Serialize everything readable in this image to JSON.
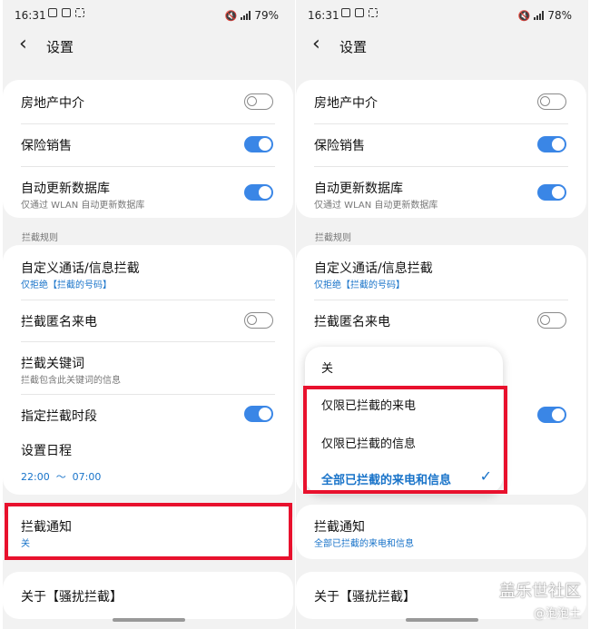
{
  "status_left": {
    "time": "16:31",
    "battery": "79%"
  },
  "status_right": {
    "time": "16:31",
    "battery": "78%"
  },
  "appbar": {
    "title": "设置"
  },
  "settings": {
    "real_estate": {
      "label": "房地产中介",
      "enabled": false
    },
    "insurance": {
      "label": "保险销售",
      "enabled": true
    },
    "auto_update": {
      "label": "自动更新数据库",
      "sub": "仅通过 WLAN 自动更新数据库",
      "enabled": true
    }
  },
  "block_rules": {
    "header": "拦截规则",
    "custom": {
      "label": "自定义通话/信息拦截",
      "sub": "仅拒绝【拦截的号码】"
    },
    "anonymous": {
      "label": "拦截匿名来电",
      "enabled": false
    },
    "keywords": {
      "label": "拦截关键词",
      "sub": "拦截包含此关键词的信息"
    },
    "time_slot": {
      "label": "指定拦截时段",
      "enabled": true
    },
    "schedule": {
      "label": "设置日程",
      "range": "22:00  ～  07:00"
    }
  },
  "notify_left": {
    "label": "拦截通知",
    "value": "关"
  },
  "notify_right": {
    "label": "拦截通知",
    "value": "全部已拦截的来电和信息"
  },
  "about": {
    "label": "关于【骚扰拦截】"
  },
  "popup": {
    "options": [
      "关",
      "仅限已拦截的来电",
      "仅限已拦截的信息",
      "全部已拦截的来电和信息"
    ],
    "selected_index": 3
  },
  "watermark": {
    "line1": "盖乐世社区",
    "line2": "@泡泡土"
  },
  "colors": {
    "accent": "#3a86e6",
    "highlight": "#e8112d",
    "link": "#1873c9"
  }
}
